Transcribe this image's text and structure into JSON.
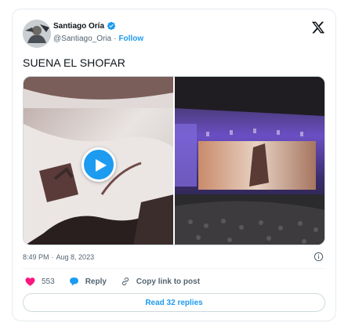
{
  "author": {
    "name": "Santiago Oría",
    "handle": "@Santiago_Oria",
    "separator": "·",
    "follow_label": "Follow"
  },
  "tweet": {
    "text": "SUENA EL SHOFAR",
    "time": "8:49 PM",
    "date_separator": "·",
    "date": "Aug 8, 2023"
  },
  "icons": {
    "verified": "verified-badge-icon",
    "x_logo": "x-logo-icon",
    "play": "play-icon",
    "info": "info-icon",
    "heart": "heart-icon",
    "reply": "reply-bubble-icon",
    "link": "link-icon"
  },
  "actions": {
    "like_count": "553",
    "reply_label": "Reply",
    "copy_link_label": "Copy link to post"
  },
  "read_replies_label": "Read 32 replies",
  "colors": {
    "accent": "#1d9bf0",
    "like": "#f91880",
    "text_primary": "#0f1419",
    "text_secondary": "#536471"
  }
}
